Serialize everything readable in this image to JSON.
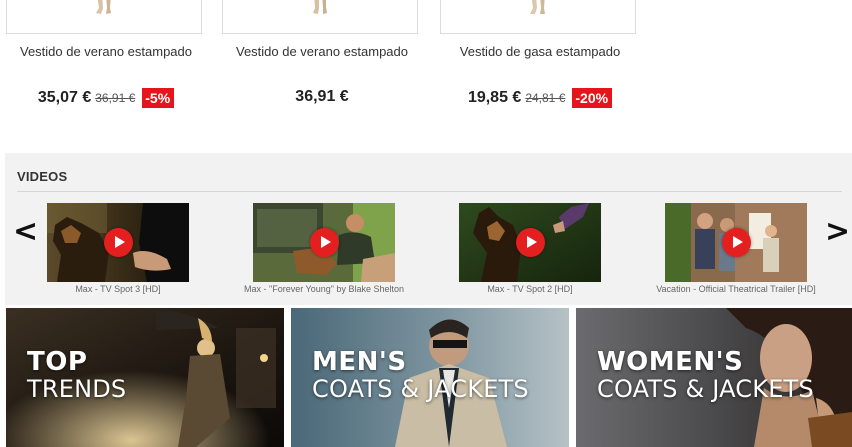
{
  "products": [
    {
      "name": "Vestido de verano estampado",
      "price": "35,07 €",
      "old_price": "36,91 €",
      "discount": "-5%"
    },
    {
      "name": "Vestido de verano estampado",
      "price": "36,91 €",
      "old_price": "",
      "discount": ""
    },
    {
      "name": "Vestido de gasa estampado",
      "price": "19,85 €",
      "old_price": "24,81 €",
      "discount": "-20%"
    }
  ],
  "videos": {
    "title": "VIDEOS",
    "prev_symbol": "<",
    "next_symbol": ">",
    "items": [
      {
        "caption": "Max - TV Spot 3 [HD]"
      },
      {
        "caption": "Max - \"Forever Young\" by Blake Shelton"
      },
      {
        "caption": "Max - TV Spot 2 [HD]"
      },
      {
        "caption": "Vacation - Official Theatrical Trailer [HD]"
      }
    ]
  },
  "banners": [
    {
      "line1": "TOP",
      "line2": "TRENDS"
    },
    {
      "line1": "MEN'S",
      "line2": "COATS & JACKETS"
    },
    {
      "line1": "WOMEN'S",
      "line2": "COATS & JACKETS"
    }
  ],
  "colors": {
    "discount_badge": "#e4161b",
    "play_button": "#e3201f",
    "videos_background": "#f2f2f2"
  },
  "icons": {
    "play": "play-icon",
    "prev": "chevron-left-icon",
    "next": "chevron-right-icon"
  }
}
